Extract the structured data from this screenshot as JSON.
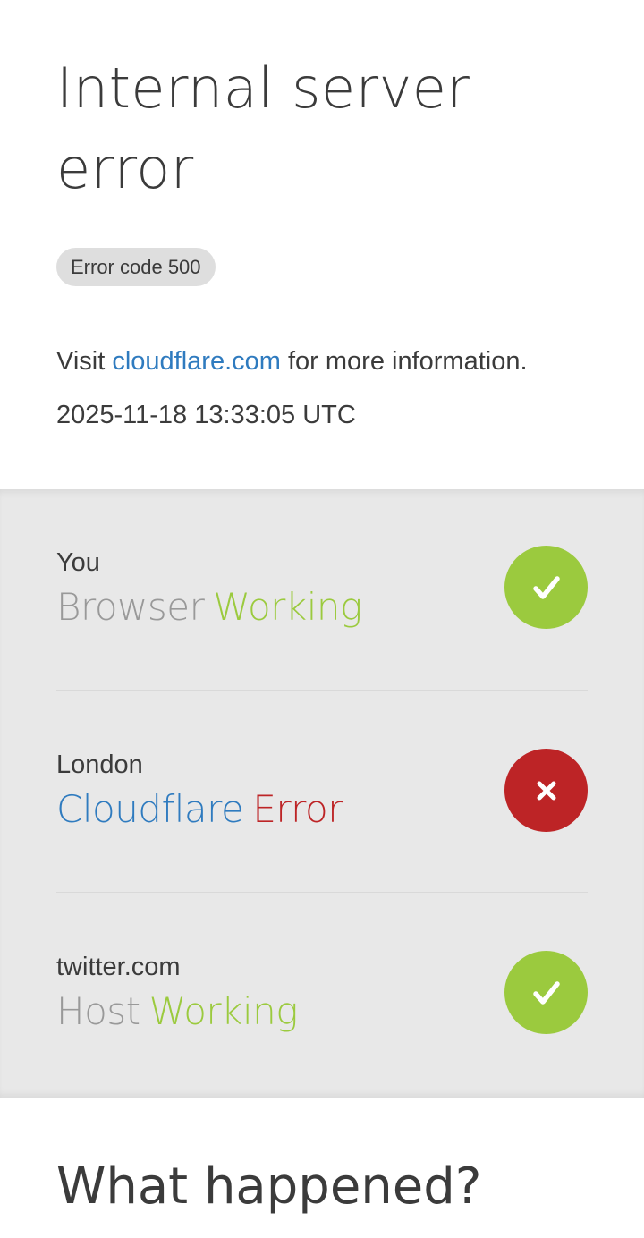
{
  "header": {
    "title": "Internal server error",
    "error_code": "Error code 500",
    "visit_prefix": "Visit",
    "visit_link": "cloudflare.com",
    "visit_suffix": "for more information.",
    "timestamp": "2025-11-18 13:33:05 UTC"
  },
  "status": {
    "rows": [
      {
        "location": "You",
        "kind": "Browser",
        "state": "Working",
        "icon": "check-icon"
      },
      {
        "location": "London",
        "kind": "Cloudflare",
        "state": "Error",
        "icon": "close-icon"
      },
      {
        "location": "twitter.com",
        "kind": "Host",
        "state": "Working",
        "icon": "check-icon"
      }
    ]
  },
  "footer": {
    "heading": "What happened?"
  },
  "colors": {
    "working": "#9bca3e",
    "error": "#bd2426",
    "link": "#2f7bbf"
  }
}
